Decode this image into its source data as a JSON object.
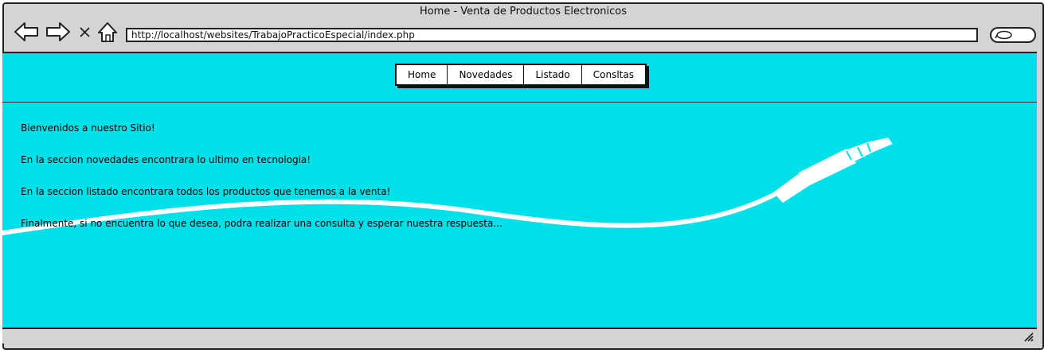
{
  "window": {
    "title": "Home - Venta de Productos Electronicos"
  },
  "toolbar": {
    "back_icon": "back-arrow-icon",
    "forward_icon": "forward-arrow-icon",
    "stop_icon": "close-icon",
    "home_icon": "home-icon",
    "url": "http://localhost/websites/TrabajoPracticoEspecial/index.php",
    "search_icon": "search-icon"
  },
  "nav": {
    "tabs": [
      {
        "label": "Home"
      },
      {
        "label": "Novedades"
      },
      {
        "label": "Listado"
      },
      {
        "label": "Consltas"
      }
    ]
  },
  "main": {
    "lines": [
      "Bienvenidos a nuestro Sitio!",
      "En la seccion novedades encontrara lo ultimo en tecnologia!",
      "En la seccion listado encontrara todos los productos que tenemos a la venta!",
      "Finalmente, si no encuentra lo que desea, podra realizar una consulta y esperar nuestra respuesta..."
    ]
  },
  "colors": {
    "page_background": "#00e0e8",
    "chrome": "#d4d4d4"
  }
}
